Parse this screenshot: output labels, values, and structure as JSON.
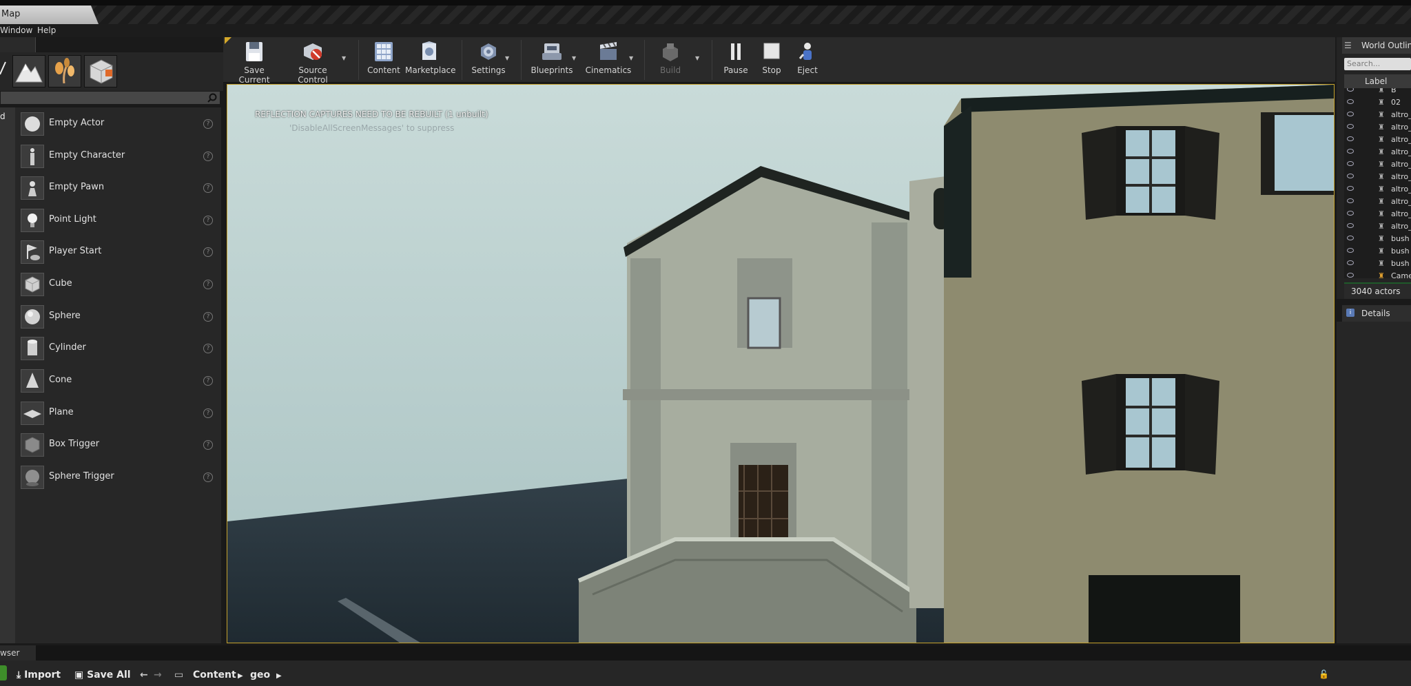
{
  "window": {
    "title": "Map"
  },
  "menu": {
    "window": "Window",
    "help": "Help"
  },
  "modes": {
    "search_placeholder": "",
    "category_label": "d",
    "items": [
      {
        "label": "Empty Actor",
        "icon": "sphere-icon"
      },
      {
        "label": "Empty Character",
        "icon": "character-icon"
      },
      {
        "label": "Empty Pawn",
        "icon": "pawn-icon"
      },
      {
        "label": "Point Light",
        "icon": "light-bulb-icon"
      },
      {
        "label": "Player Start",
        "icon": "player-start-icon"
      },
      {
        "label": "Cube",
        "icon": "cube-icon"
      },
      {
        "label": "Sphere",
        "icon": "sphere-icon"
      },
      {
        "label": "Cylinder",
        "icon": "cylinder-icon"
      },
      {
        "label": "Cone",
        "icon": "cone-icon"
      },
      {
        "label": "Plane",
        "icon": "plane-icon"
      },
      {
        "label": "Box Trigger",
        "icon": "box-trigger-icon"
      },
      {
        "label": "Sphere Trigger",
        "icon": "sphere-trigger-icon"
      }
    ]
  },
  "toolbar": {
    "save_current": "Save Current",
    "source_control": "Source Control",
    "content": "Content",
    "marketplace": "Marketplace",
    "settings": "Settings",
    "blueprints": "Blueprints",
    "cinematics": "Cinematics",
    "build": "Build",
    "pause": "Pause",
    "stop": "Stop",
    "eject": "Eject"
  },
  "viewport": {
    "message": "REFLECTION CAPTURES NEED TO BE REBUILT (1 unbuilt)",
    "hint": "'DisableAllScreenMessages' to suppress"
  },
  "outliner": {
    "title": "World Outliner",
    "search_placeholder": "Search...",
    "column_label": "Label",
    "rows": [
      "B",
      "02",
      "altro_",
      "altro_",
      "altro_",
      "altro_",
      "altro_",
      "altro_",
      "altro_",
      "altro_",
      "altro_",
      "altro_",
      "bush",
      "bush",
      "bush",
      "Came"
    ],
    "count": "3040 actors"
  },
  "details": {
    "title": "Details"
  },
  "content_browser": {
    "tab": "wser",
    "import": "Import",
    "save_all": "Save All",
    "path": [
      "Content",
      "geo"
    ]
  }
}
